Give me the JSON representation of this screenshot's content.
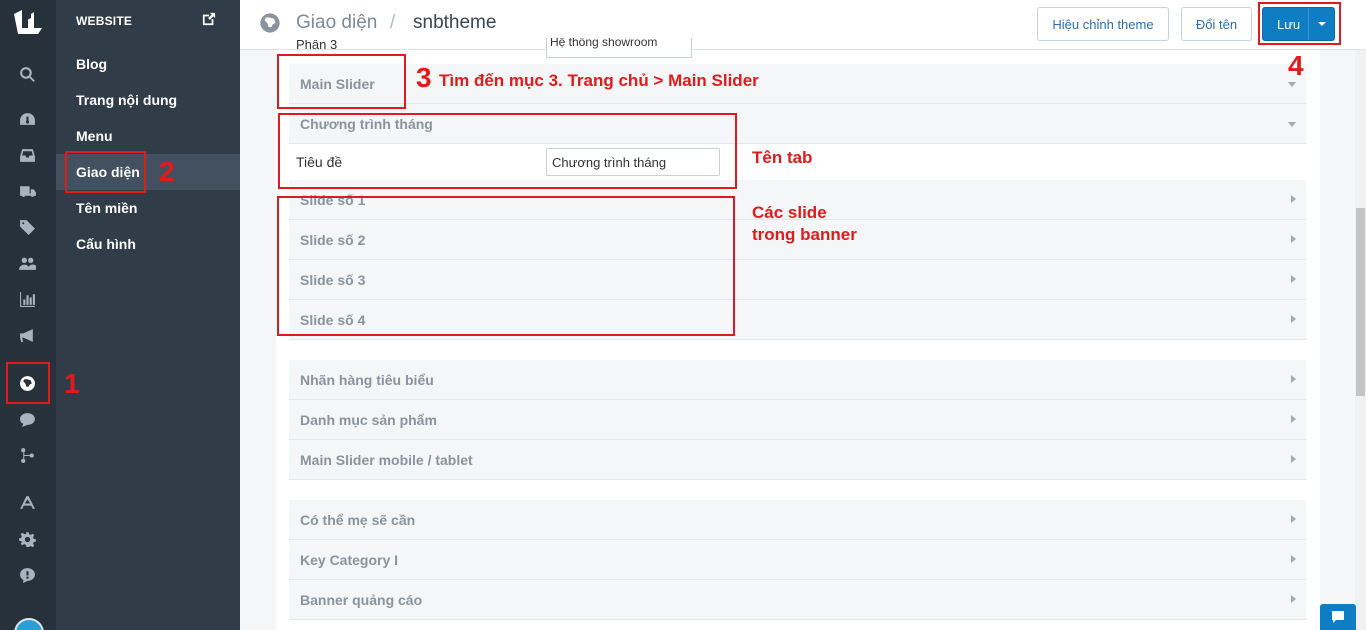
{
  "sidebar": {
    "section_title": "WEBSITE",
    "items": [
      {
        "label": "Blog"
      },
      {
        "label": "Trang nội dung"
      },
      {
        "label": "Menu"
      },
      {
        "label": "Giao diện"
      },
      {
        "label": "Tên miền"
      },
      {
        "label": "Cấu hình"
      }
    ],
    "active_item": "Giao diện"
  },
  "rail": {
    "icons": [
      "logo-icon",
      "search-icon",
      "dashboard-icon",
      "inbox-icon",
      "truck-icon",
      "tag-icon",
      "users-icon",
      "bar-chart-icon",
      "megaphone-icon",
      "globe-icon",
      "chat-icon",
      "flow-icon",
      "app-store-icon",
      "gear-icon",
      "alert-icon"
    ],
    "active_icon": "globe-icon"
  },
  "header": {
    "breadcrumb_parent": "Giao diện",
    "breadcrumb_separator": "/",
    "breadcrumb_current": "snbtheme",
    "edit_theme_label": "Hiệu chỉnh theme",
    "rename_label": "Đổi tên",
    "save_label": "Lưu"
  },
  "panel": {
    "partial_top_label": "Phần 3",
    "partial_top_select": "Hệ thống showroom",
    "sections": [
      {
        "label": "Main Slider",
        "state": "expanded"
      },
      {
        "label": "Chương trình tháng",
        "state": "expanded"
      },
      {
        "label": "Slide số 1",
        "state": "collapsed"
      },
      {
        "label": "Slide số 2",
        "state": "collapsed"
      },
      {
        "label": "Slide số 3",
        "state": "collapsed"
      },
      {
        "label": "Slide số 4",
        "state": "collapsed"
      },
      {
        "label": "Nhãn hàng tiêu biểu",
        "state": "collapsed"
      },
      {
        "label": "Danh mục sản phẩm",
        "state": "collapsed"
      },
      {
        "label": "Main Slider mobile / tablet",
        "state": "collapsed"
      },
      {
        "label": "Có thể mẹ sẽ cần",
        "state": "collapsed"
      },
      {
        "label": "Key Category I",
        "state": "collapsed"
      },
      {
        "label": "Banner quảng cáo",
        "state": "collapsed"
      }
    ],
    "title_field_label": "Tiêu đề",
    "title_field_value": "Chương trình tháng"
  },
  "annotations": {
    "n1": "1",
    "n2": "2",
    "n3": "3",
    "n4": "4",
    "step3_text": "Tìm đến mục 3. Trang chủ > Main Slider",
    "tab_name_text": "Tên tab",
    "slides_text_line1": "Các slide",
    "slides_text_line2": "trong banner"
  },
  "colors": {
    "rail_bg": "#27313b",
    "sidebar_bg": "#303c47",
    "primary": "#0f7dc3",
    "annotation_red": "#e01b1b"
  }
}
